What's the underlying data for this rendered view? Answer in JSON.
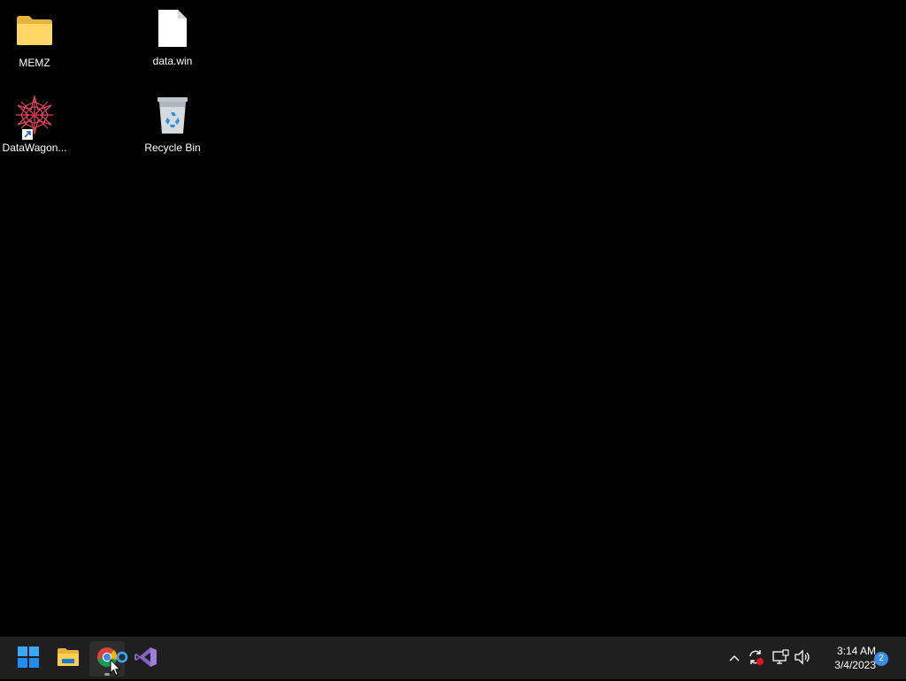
{
  "desktop": {
    "icons": [
      {
        "name": "MEMZ",
        "icon": "folder-icon"
      },
      {
        "name": "data.win",
        "icon": "file-icon"
      },
      {
        "name": "DataWagon...",
        "icon": "datawagon-shortcut-icon"
      },
      {
        "name": "Recycle Bin",
        "icon": "recycle-bin-icon"
      }
    ]
  },
  "taskbar": {
    "pinned": [
      {
        "name": "Start",
        "icon": "windows-start-icon"
      },
      {
        "name": "File Explorer",
        "icon": "file-explorer-icon"
      },
      {
        "name": "Google Chrome",
        "icon": "chrome-icon"
      },
      {
        "name": "Visual Studio",
        "icon": "visual-studio-icon"
      }
    ],
    "tray": {
      "icons": [
        "chevron-up-icon",
        "sync-icon",
        "network-icon",
        "volume-icon"
      ],
      "time": "3:14 AM",
      "date": "3/4/2023",
      "notification_count": "2"
    }
  },
  "colors": {
    "desktop_bg": "#000000",
    "taskbar_bg": "#1f1f1f",
    "accent": "#3a8ee6"
  }
}
